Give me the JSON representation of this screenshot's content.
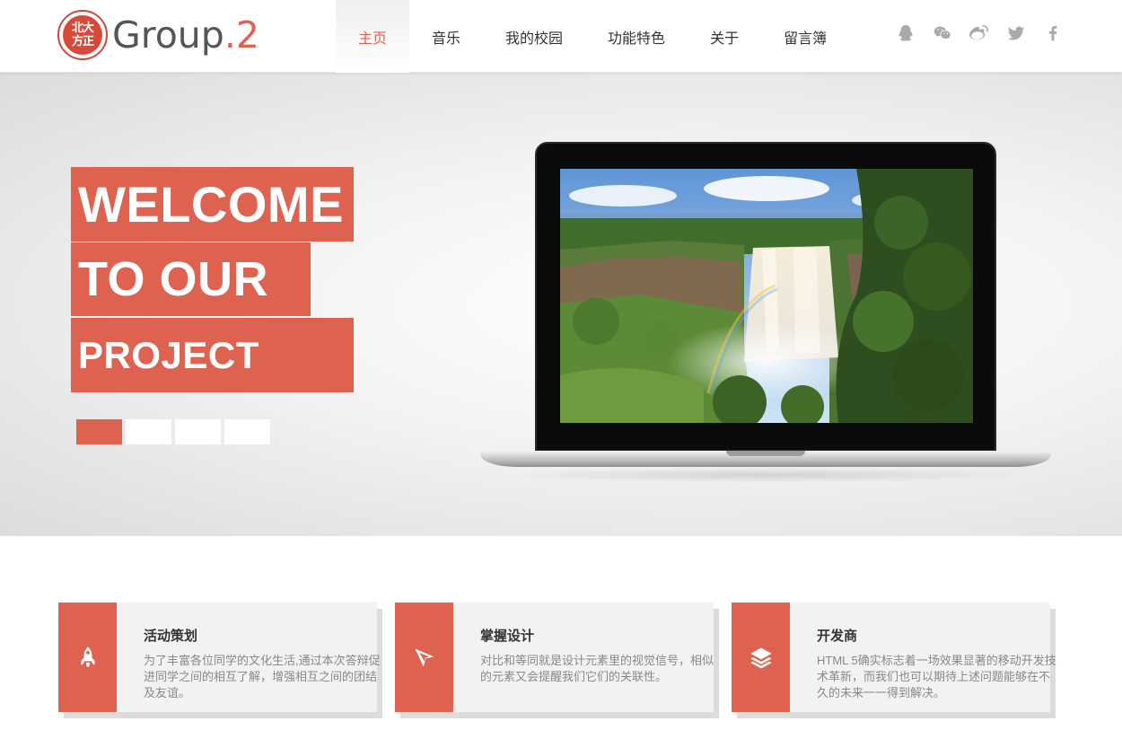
{
  "logo": {
    "seal_text": "北大方正",
    "name_main": "Group",
    "name_suffix": ".2"
  },
  "nav": {
    "items": [
      {
        "label": "主页",
        "active": true
      },
      {
        "label": "音乐",
        "active": false
      },
      {
        "label": "我的校园",
        "active": false
      },
      {
        "label": "功能特色",
        "active": false
      },
      {
        "label": "关于",
        "active": false
      },
      {
        "label": "留言簿",
        "active": false
      }
    ]
  },
  "social": [
    "qq-icon",
    "wechat-icon",
    "weibo-icon",
    "twitter-icon",
    "facebook-icon"
  ],
  "hero": {
    "line1": "WELCOME",
    "line2": "TO OUR",
    "line3": "PROJECT",
    "slides": 4,
    "active_slide": 1,
    "image": "waterfall-landscape on laptop screen"
  },
  "cards": [
    {
      "icon": "rocket-icon",
      "title": "活动策划",
      "text": "为了丰富各位同学的文化生活,通过本次答辩促进同学之间的相互了解，增强相互之间的团结及友谊。"
    },
    {
      "icon": "paper-plane-icon",
      "title": "掌握设计",
      "text": "对比和等同就是设计元素里的视觉信号，相似的元素又会提醒我们它们的关联性。"
    },
    {
      "icon": "layers-icon",
      "title": "开发商",
      "text": "HTML 5确实标志着一场效果显著的移动开发技术革新，而我们也可以期待上述问题能够在不久的未来一一得到解决。"
    }
  ],
  "colors": {
    "accent": "#dd6250",
    "text": "#333333",
    "muted": "#888888",
    "icon_gray": "#a9a9a9"
  }
}
